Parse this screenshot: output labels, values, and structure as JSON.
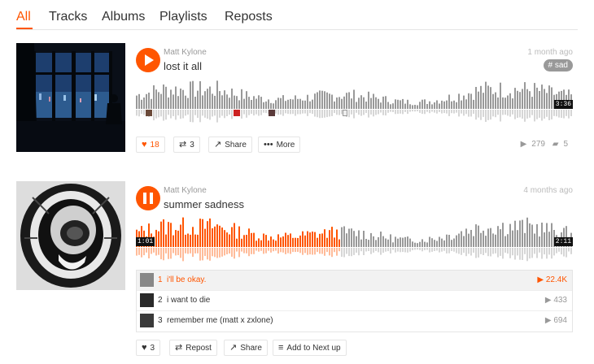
{
  "tabs": [
    {
      "label": "All",
      "active": true
    },
    {
      "label": "Tracks",
      "active": false
    },
    {
      "label": "Albums",
      "active": false
    },
    {
      "label": "Playlists",
      "active": false
    },
    {
      "label": "Reposts",
      "active": false
    }
  ],
  "colors": {
    "accent": "#ff5500",
    "wave_unplayed": "#999999",
    "wave_played": "#ff5500"
  },
  "track1": {
    "artist": "Matt Kylone",
    "title": "lost it all",
    "time_ago": "1 month ago",
    "tag": "# sad",
    "duration": "3:36",
    "state": "paused",
    "progress": 0,
    "likes": "18",
    "reposts": "3",
    "share_label": "Share",
    "more_label": "More",
    "plays": "279",
    "comments": "5"
  },
  "track2": {
    "artist": "Matt Kylone",
    "title": "summer sadness",
    "time_ago": "4 months ago",
    "current_time": "1:01",
    "duration": "2:11",
    "state": "playing",
    "progress": 0.465,
    "playlist": [
      {
        "num": "1",
        "title": "i'll be okay.",
        "plays": "22.4K",
        "active": true
      },
      {
        "num": "2",
        "title": "i want to die",
        "plays": "433",
        "active": false
      },
      {
        "num": "3",
        "title": "remember me (matt x zxlone)",
        "plays": "694",
        "active": false
      }
    ],
    "likes": "3",
    "repost_label": "Repost",
    "share_label": "Share",
    "next_up_label": "Add to Next up"
  }
}
